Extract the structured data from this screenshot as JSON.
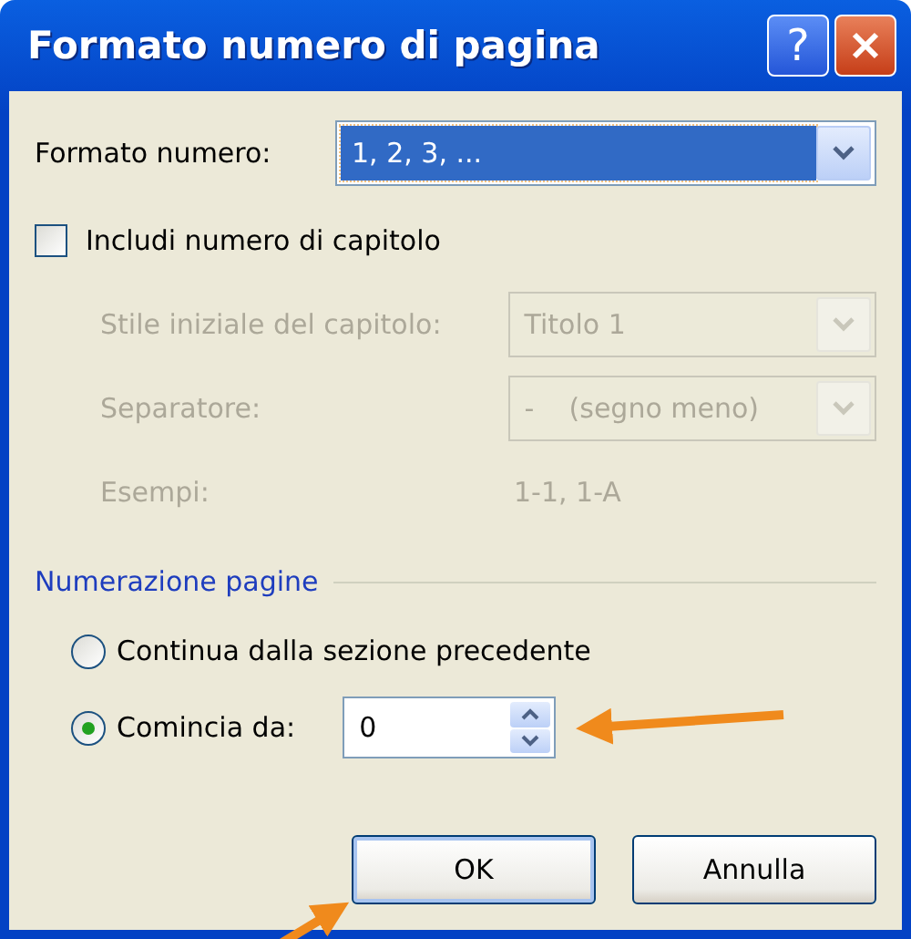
{
  "window": {
    "title": "Formato numero di pagina",
    "title_buttons": [
      {
        "kind": "help",
        "text": "?"
      },
      {
        "kind": "close"
      }
    ]
  },
  "number_format": {
    "label": "Formato numero:",
    "value": "1, 2, 3, ...",
    "selected": true
  },
  "include_chapter": {
    "label": "Includi numero di capitolo",
    "checked": false
  },
  "chapter_options": {
    "disabled": true,
    "rows": [
      {
        "kind": "dropdown",
        "label": "Stile iniziale del capitolo:",
        "value": "Titolo 1"
      },
      {
        "kind": "dropdown",
        "label": "Separatore:",
        "value": "-    (segno meno)"
      },
      {
        "kind": "text",
        "label": "Esempi:",
        "value": "1-1, 1-A"
      }
    ]
  },
  "page_numbering": {
    "title": "Numerazione pagine",
    "options": [
      {
        "kind": "radio",
        "label": "Continua dalla sezione precedente",
        "selected": false
      },
      {
        "kind": "radio_spin",
        "label": "Comincia da:",
        "selected": true,
        "value": "0",
        "arrow_pointer": true
      }
    ]
  },
  "buttons": [
    {
      "label": "OK",
      "default": true,
      "arrow_pointer": true
    },
    {
      "label": "Annulla",
      "default": false,
      "arrow_pointer": false
    }
  ]
}
